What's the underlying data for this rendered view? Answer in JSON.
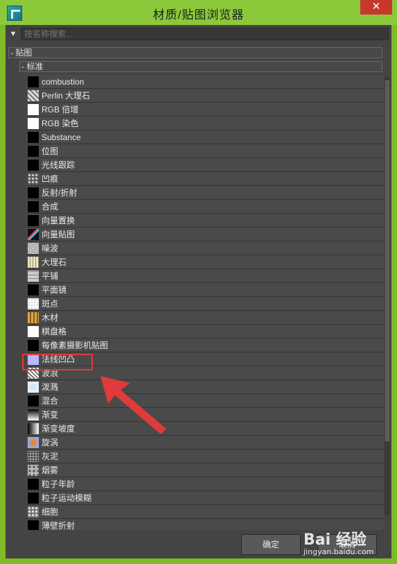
{
  "window": {
    "title": "材质/贴图浏览器",
    "close": "✕"
  },
  "search": {
    "placeholder": "按名称搜索..."
  },
  "groups": {
    "maps": "- 贴图",
    "standard": "- 标准"
  },
  "items": [
    {
      "label": "combustion",
      "thumb": "#000000"
    },
    {
      "label": "Perlin 大理石",
      "thumb": "marble"
    },
    {
      "label": "RGB 倍增",
      "thumb": "#ffffff"
    },
    {
      "label": "RGB 染色",
      "thumb": "#ffffff"
    },
    {
      "label": "Substance",
      "thumb": "#000000"
    },
    {
      "label": "位图",
      "thumb": "#000000"
    },
    {
      "label": "光线跟踪",
      "thumb": "#000000"
    },
    {
      "label": "凹痕",
      "thumb": "dents"
    },
    {
      "label": "反射/折射",
      "thumb": "#000000"
    },
    {
      "label": "合成",
      "thumb": "#000000"
    },
    {
      "label": "向量置换",
      "thumb": "#000000"
    },
    {
      "label": "向量贴图",
      "thumb": "vector"
    },
    {
      "label": "噪波",
      "thumb": "noise"
    },
    {
      "label": "大理石",
      "thumb": "marble2"
    },
    {
      "label": "平铺",
      "thumb": "tiles"
    },
    {
      "label": "平面镜",
      "thumb": "#000000"
    },
    {
      "label": "斑点",
      "thumb": "speckle"
    },
    {
      "label": "木材",
      "thumb": "wood"
    },
    {
      "label": "棋盘格",
      "thumb": "checker"
    },
    {
      "label": "每像素摄影机贴图",
      "thumb": "#000000"
    },
    {
      "label": "法线凹凸",
      "thumb": "#b8b8ff"
    },
    {
      "label": "波浪",
      "thumb": "waves"
    },
    {
      "label": "泼溅",
      "thumb": "splat"
    },
    {
      "label": "混合",
      "thumb": "#000000"
    },
    {
      "label": "渐变",
      "thumb": "gradient"
    },
    {
      "label": "渐变坡度",
      "thumb": "ramp"
    },
    {
      "label": "旋涡",
      "thumb": "swirl"
    },
    {
      "label": "灰泥",
      "thumb": "stucco"
    },
    {
      "label": "烟雾",
      "thumb": "smoke"
    },
    {
      "label": "粒子年龄",
      "thumb": "#000000"
    },
    {
      "label": "粒子运动模糊",
      "thumb": "#000000"
    },
    {
      "label": "细胞",
      "thumb": "cellular"
    },
    {
      "label": "薄壁折射",
      "thumb": "#000000"
    }
  ],
  "buttons": {
    "ok": "确定",
    "cancel": "取消"
  },
  "watermark": {
    "brand": "Bai 经验",
    "url": "jingyan.baidu.com"
  }
}
